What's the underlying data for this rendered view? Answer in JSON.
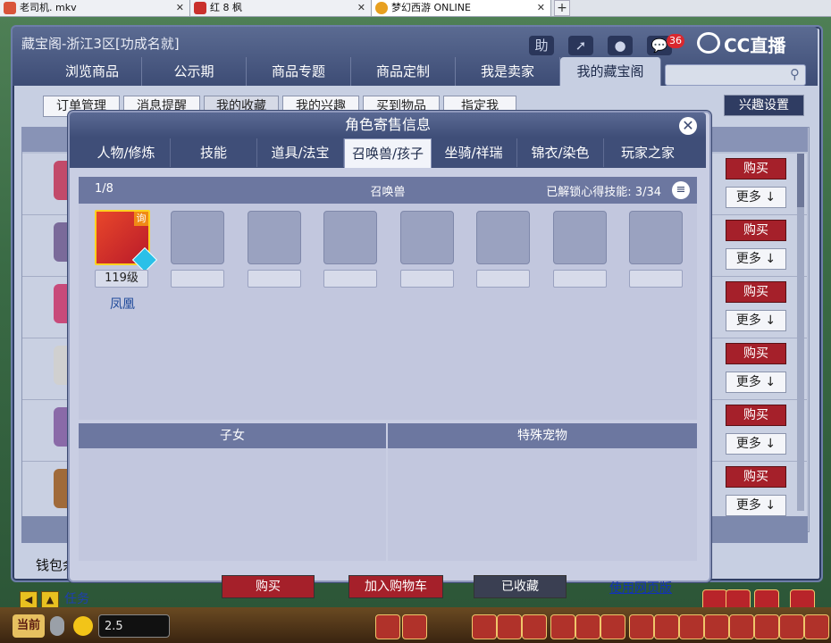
{
  "browser_tabs": [
    {
      "label": "老司机. mkv",
      "color": "#d9543a",
      "active": false
    },
    {
      "label": "红 8 枫",
      "color": "#c9302c",
      "active": false
    },
    {
      "label": "梦幻西游 ONLINE",
      "color": "#e8a020",
      "active": true
    }
  ],
  "window": {
    "title": "藏宝阁-浙江3区[功成名就]",
    "help": "助",
    "badge": "36",
    "logo": "CC直播"
  },
  "nav": {
    "tabs": [
      "浏览商品",
      "公示期",
      "商品专题",
      "商品定制",
      "我是卖家",
      "我的藏宝阁"
    ],
    "active": "我的藏宝阁",
    "search_placeholder": ""
  },
  "subnav": {
    "buttons": [
      "订单管理",
      "消息提醒",
      "我的收藏",
      "我的兴趣",
      "买到物品",
      "指定我"
    ],
    "interest_settings": "兴趣设置"
  },
  "list": {
    "buy_label": "购买",
    "more_label": "更多",
    "rows": 6
  },
  "wallet": {
    "label": "钱包余"
  },
  "modal": {
    "title": "角色寄售信息",
    "tabs": [
      "人物/修炼",
      "技能",
      "道具/法宝",
      "召唤兽/孩子",
      "坐骑/祥瑞",
      "锦衣/染色",
      "玩家之家"
    ],
    "active_tab": "召唤兽/孩子",
    "pets": {
      "page": "1/8",
      "title": "召唤兽",
      "skills_label": "已解锁心得技能:",
      "skills_value": "3/34",
      "first": {
        "level": "119级",
        "name": "凤凰",
        "inquire": "询"
      }
    },
    "sections": {
      "children": "子女",
      "special_pets": "特殊宠物"
    },
    "buttons": {
      "buy": "购买",
      "add_cart": "加入购物车",
      "collected": "已收藏"
    },
    "web_version": "使用网页版"
  },
  "game_ui": {
    "task": "任务",
    "current": "当前",
    "value": "2.5"
  }
}
